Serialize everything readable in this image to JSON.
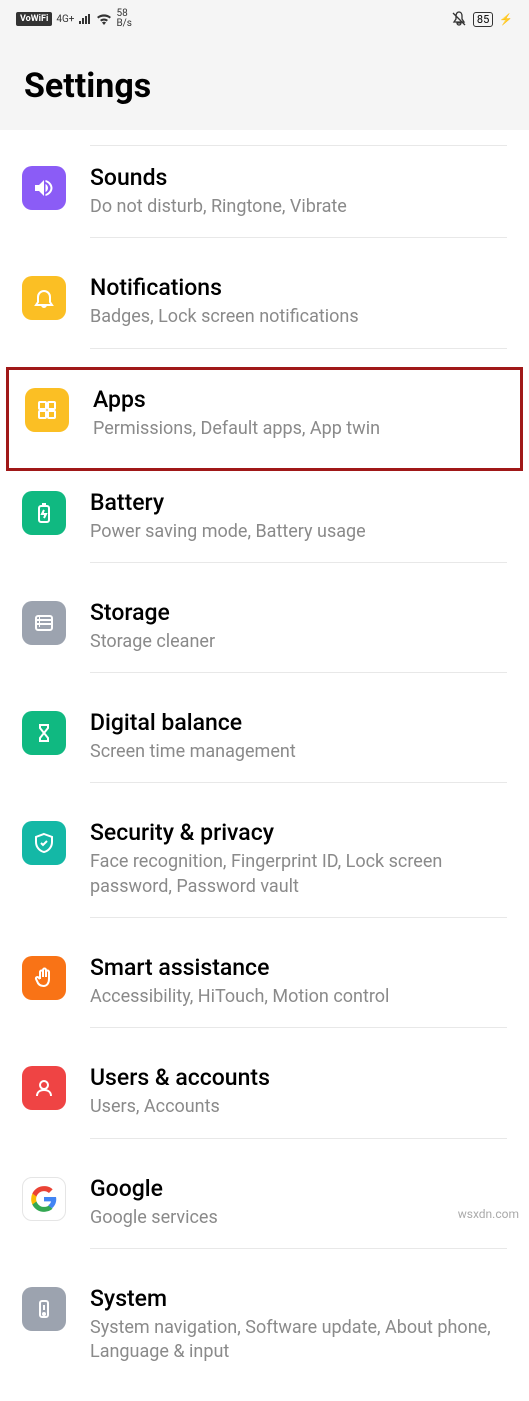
{
  "status": {
    "vowifi": "VoWiFi",
    "network": "4G+",
    "speed_value": "58",
    "speed_unit": "B/s",
    "battery": "85"
  },
  "header": {
    "title": "Settings"
  },
  "items": [
    {
      "id": "sounds",
      "title": "Sounds",
      "subtitle": "Do not disturb, Ringtone, Vibrate",
      "color": "#8b5cf6"
    },
    {
      "id": "notifications",
      "title": "Notifications",
      "subtitle": "Badges, Lock screen notifications",
      "color": "#fbbf24"
    },
    {
      "id": "apps",
      "title": "Apps",
      "subtitle": "Permissions, Default apps, App twin",
      "color": "#fbbf24",
      "highlighted": true
    },
    {
      "id": "battery",
      "title": "Battery",
      "subtitle": "Power saving mode, Battery usage",
      "color": "#10b981"
    },
    {
      "id": "storage",
      "title": "Storage",
      "subtitle": "Storage cleaner",
      "color": "#9ca3af"
    },
    {
      "id": "digital-balance",
      "title": "Digital balance",
      "subtitle": "Screen time management",
      "color": "#10b981"
    },
    {
      "id": "security",
      "title": "Security & privacy",
      "subtitle": "Face recognition, Fingerprint ID, Lock screen password, Password vault",
      "color": "#14b8a6"
    },
    {
      "id": "smart-assistance",
      "title": "Smart assistance",
      "subtitle": "Accessibility, HiTouch, Motion control",
      "color": "#f97316"
    },
    {
      "id": "users",
      "title": "Users & accounts",
      "subtitle": "Users, Accounts",
      "color": "#ef4444"
    },
    {
      "id": "google",
      "title": "Google",
      "subtitle": "Google services",
      "color": "#ffffff"
    },
    {
      "id": "system",
      "title": "System",
      "subtitle": "System navigation, Software update, About phone, Language & input",
      "color": "#9ca3af"
    }
  ],
  "watermark": "wsxdn.com"
}
